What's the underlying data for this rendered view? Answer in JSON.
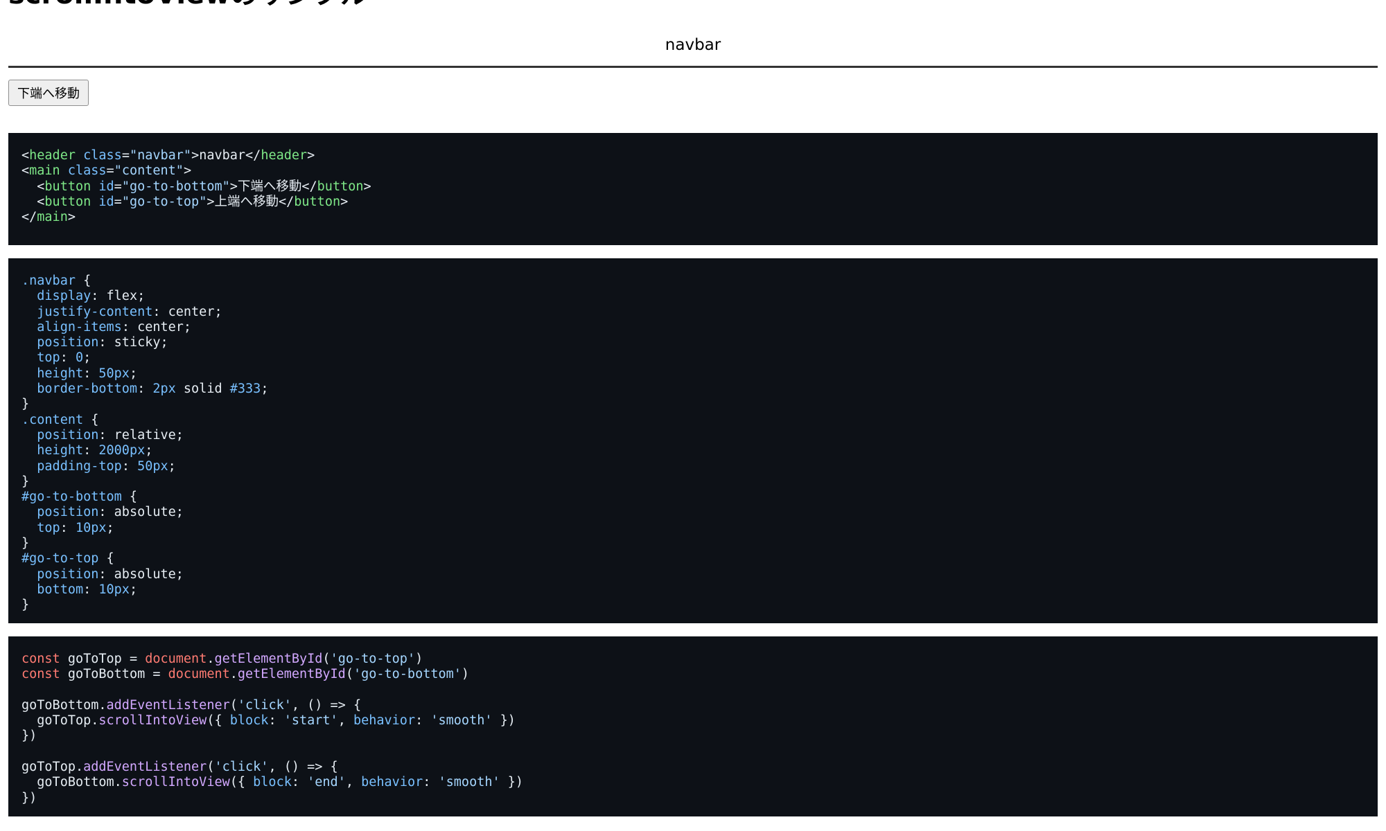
{
  "page": {
    "title": "scrollIntoViewのサンプル",
    "navbar_label": "navbar",
    "go_to_bottom_label": "下端へ移動"
  },
  "code_blocks": {
    "html": [
      [
        [
          "p",
          "<"
        ],
        [
          "tag",
          "header"
        ],
        [
          "p",
          " "
        ],
        [
          "attr",
          "class"
        ],
        [
          "p",
          "="
        ],
        [
          "str",
          "\"navbar\""
        ],
        [
          "p",
          ">navbar</"
        ],
        [
          "tag",
          "header"
        ],
        [
          "p",
          ">"
        ]
      ],
      [
        [
          "p",
          "<"
        ],
        [
          "tag",
          "main"
        ],
        [
          "p",
          " "
        ],
        [
          "attr",
          "class"
        ],
        [
          "p",
          "="
        ],
        [
          "str",
          "\"content\""
        ],
        [
          "p",
          ">"
        ]
      ],
      [
        [
          "p",
          "  <"
        ],
        [
          "tag",
          "button"
        ],
        [
          "p",
          " "
        ],
        [
          "attr",
          "id"
        ],
        [
          "p",
          "="
        ],
        [
          "str",
          "\"go-to-bottom\""
        ],
        [
          "p",
          ">下端へ移動</"
        ],
        [
          "tag",
          "button"
        ],
        [
          "p",
          ">"
        ]
      ],
      [
        [
          "p",
          "  <"
        ],
        [
          "tag",
          "button"
        ],
        [
          "p",
          " "
        ],
        [
          "attr",
          "id"
        ],
        [
          "p",
          "="
        ],
        [
          "str",
          "\"go-to-top\""
        ],
        [
          "p",
          ">上端へ移動</"
        ],
        [
          "tag",
          "button"
        ],
        [
          "p",
          ">"
        ]
      ],
      [
        [
          "p",
          "</"
        ],
        [
          "tag",
          "main"
        ],
        [
          "p",
          ">"
        ]
      ]
    ],
    "css": [
      [
        [
          "sel",
          ".navbar"
        ],
        [
          "p",
          " {"
        ]
      ],
      [
        [
          "p",
          "  "
        ],
        [
          "prop",
          "display"
        ],
        [
          "p",
          ": flex;"
        ]
      ],
      [
        [
          "p",
          "  "
        ],
        [
          "prop",
          "justify-content"
        ],
        [
          "p",
          ": center;"
        ]
      ],
      [
        [
          "p",
          "  "
        ],
        [
          "prop",
          "align-items"
        ],
        [
          "p",
          ": center;"
        ]
      ],
      [
        [
          "p",
          "  "
        ],
        [
          "prop",
          "position"
        ],
        [
          "p",
          ": sticky;"
        ]
      ],
      [
        [
          "p",
          "  "
        ],
        [
          "prop",
          "top"
        ],
        [
          "p",
          ": "
        ],
        [
          "num",
          "0"
        ],
        [
          "p",
          ";"
        ]
      ],
      [
        [
          "p",
          "  "
        ],
        [
          "prop",
          "height"
        ],
        [
          "p",
          ": "
        ],
        [
          "num",
          "50px"
        ],
        [
          "p",
          ";"
        ]
      ],
      [
        [
          "p",
          "  "
        ],
        [
          "prop",
          "border-bottom"
        ],
        [
          "p",
          ": "
        ],
        [
          "num",
          "2px"
        ],
        [
          "p",
          " solid "
        ],
        [
          "num",
          "#333"
        ],
        [
          "p",
          ";"
        ]
      ],
      [
        [
          "p",
          "}"
        ]
      ],
      [
        [
          "sel",
          ".content"
        ],
        [
          "p",
          " {"
        ]
      ],
      [
        [
          "p",
          "  "
        ],
        [
          "prop",
          "position"
        ],
        [
          "p",
          ": relative;"
        ]
      ],
      [
        [
          "p",
          "  "
        ],
        [
          "prop",
          "height"
        ],
        [
          "p",
          ": "
        ],
        [
          "num",
          "2000px"
        ],
        [
          "p",
          ";"
        ]
      ],
      [
        [
          "p",
          "  "
        ],
        [
          "prop",
          "padding-top"
        ],
        [
          "p",
          ": "
        ],
        [
          "num",
          "50px"
        ],
        [
          "p",
          ";"
        ]
      ],
      [
        [
          "p",
          "}"
        ]
      ],
      [
        [
          "sel",
          "#go-to-bottom"
        ],
        [
          "p",
          " {"
        ]
      ],
      [
        [
          "p",
          "  "
        ],
        [
          "prop",
          "position"
        ],
        [
          "p",
          ": absolute;"
        ]
      ],
      [
        [
          "p",
          "  "
        ],
        [
          "prop",
          "top"
        ],
        [
          "p",
          ": "
        ],
        [
          "num",
          "10px"
        ],
        [
          "p",
          ";"
        ]
      ],
      [
        [
          "p",
          "}"
        ]
      ],
      [
        [
          "sel",
          "#go-to-top"
        ],
        [
          "p",
          " {"
        ]
      ],
      [
        [
          "p",
          "  "
        ],
        [
          "prop",
          "position"
        ],
        [
          "p",
          ": absolute;"
        ]
      ],
      [
        [
          "p",
          "  "
        ],
        [
          "prop",
          "bottom"
        ],
        [
          "p",
          ": "
        ],
        [
          "num",
          "10px"
        ],
        [
          "p",
          ";"
        ]
      ],
      [
        [
          "p",
          "}"
        ]
      ]
    ],
    "js": [
      [
        [
          "kw",
          "const"
        ],
        [
          "p",
          " goToTop = "
        ],
        [
          "kw",
          "document"
        ],
        [
          "p",
          "."
        ],
        [
          "fn",
          "getElementById"
        ],
        [
          "p",
          "("
        ],
        [
          "str",
          "'go-to-top'"
        ],
        [
          "p",
          ")"
        ]
      ],
      [
        [
          "kw",
          "const"
        ],
        [
          "p",
          " goToBottom = "
        ],
        [
          "kw",
          "document"
        ],
        [
          "p",
          "."
        ],
        [
          "fn",
          "getElementById"
        ],
        [
          "p",
          "("
        ],
        [
          "str",
          "'go-to-bottom'"
        ],
        [
          "p",
          ")"
        ]
      ],
      [
        [
          "p",
          ""
        ]
      ],
      [
        [
          "p",
          "goToBottom."
        ],
        [
          "fn",
          "addEventListener"
        ],
        [
          "p",
          "("
        ],
        [
          "str",
          "'click'"
        ],
        [
          "p",
          ", () => {"
        ]
      ],
      [
        [
          "p",
          "  goToTop."
        ],
        [
          "fn",
          "scrollIntoView"
        ],
        [
          "p",
          "({ "
        ],
        [
          "prop",
          "block"
        ],
        [
          "p",
          ": "
        ],
        [
          "str",
          "'start'"
        ],
        [
          "p",
          ", "
        ],
        [
          "prop",
          "behavior"
        ],
        [
          "p",
          ": "
        ],
        [
          "str",
          "'smooth'"
        ],
        [
          "p",
          " })"
        ]
      ],
      [
        [
          "p",
          "})"
        ]
      ],
      [
        [
          "p",
          ""
        ]
      ],
      [
        [
          "p",
          "goToTop."
        ],
        [
          "fn",
          "addEventListener"
        ],
        [
          "p",
          "("
        ],
        [
          "str",
          "'click'"
        ],
        [
          "p",
          ", () => {"
        ]
      ],
      [
        [
          "p",
          "  goToBottom."
        ],
        [
          "fn",
          "scrollIntoView"
        ],
        [
          "p",
          "({ "
        ],
        [
          "prop",
          "block"
        ],
        [
          "p",
          ": "
        ],
        [
          "str",
          "'end'"
        ],
        [
          "p",
          ", "
        ],
        [
          "prop",
          "behavior"
        ],
        [
          "p",
          ": "
        ],
        [
          "str",
          "'smooth'"
        ],
        [
          "p",
          " })"
        ]
      ],
      [
        [
          "p",
          "})"
        ]
      ]
    ]
  }
}
